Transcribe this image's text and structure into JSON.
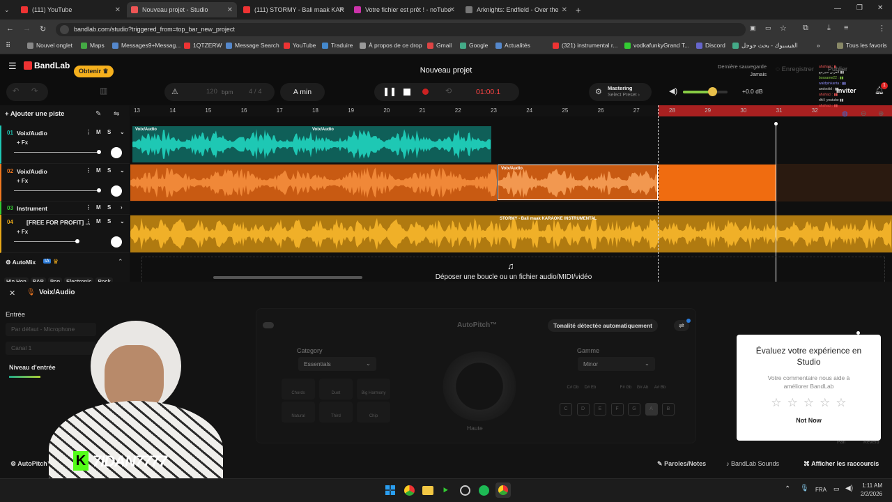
{
  "tabs": [
    {
      "title": "(111) YouTube",
      "color": "#e33"
    },
    {
      "title": "Nouveau projet - Studio",
      "color": "#e55"
    },
    {
      "title": "(111) STORMY - Bali maak KAR",
      "color": "#e33"
    },
    {
      "title": "Votre fichier est prêt ! - noTube",
      "color": "#c3a"
    },
    {
      "title": "Arknights: Endfield - Over the",
      "color": "#777"
    }
  ],
  "url": "bandlab.com/studio?triggered_from=top_bar_new_project",
  "bookmarks": [
    "Nouvel onglet",
    "Maps",
    "Messages9+Messag...",
    "1QTZERW",
    "Message Search",
    "YouTube",
    "Traduire",
    "À propos de ce drop",
    "Gmail",
    "Google",
    "Actualités",
    "(321) instrumental r...",
    "vodkafunkyGrand T...",
    "Discord",
    "الفيسبوك - بحث جوجل",
    "Tous les favoris"
  ],
  "app": {
    "brand": "BandLab",
    "obtenir": "Obtenir",
    "project_title": "Nouveau projet",
    "save_label": "Dernière sauvegarde",
    "save_value": "Jamais",
    "save_button": "Enregistrer",
    "publish_button": "Publier",
    "invite_button": "Inviter"
  },
  "toolbar": {
    "bpm_value": "120",
    "bpm_unit": "bpm",
    "signature": "4 / 4",
    "key": "A min",
    "time": "01:00.1",
    "mastering_title": "Mastering",
    "mastering_sub": "Select Preset",
    "volume_db": "+0.0 dB",
    "volume_level": 0.65
  },
  "ruler": [
    "13",
    "14",
    "15",
    "16",
    "17",
    "18",
    "19",
    "20",
    "21",
    "22",
    "23",
    "24",
    "25",
    "26",
    "27",
    "28",
    "29",
    "30",
    "31",
    "32"
  ],
  "tracks": [
    {
      "num": "01",
      "name": "Voix/Audio",
      "fx": "+ Fx",
      "color": "#1ec8b4",
      "m": "M",
      "s": "S"
    },
    {
      "num": "02",
      "name": "Voix/Audio",
      "fx": "+ Fx",
      "color": "#f07820",
      "m": "M",
      "s": "S"
    },
    {
      "num": "03",
      "name": "Instrument",
      "fx": "",
      "color": "#3c3",
      "m": "M",
      "s": "S"
    },
    {
      "num": "04",
      "name": "[FREE FOR PROFIT] ...",
      "fx": "+ Fx",
      "color": "#e8a818",
      "m": "M",
      "s": "S"
    }
  ],
  "clips": {
    "c1a": "Voix/Audio",
    "c1b": "Voix/Audio",
    "c2": "Voix/Audio",
    "c4": "STORMY - Bali maak KARAOKE INSTRUMENTAL"
  },
  "add_track": "Ajouter une piste",
  "automix": {
    "label": "AutoMix",
    "badge": "IA",
    "genres": [
      "Hip Hop",
      "R&B",
      "Pop",
      "Electronic",
      "Rock"
    ]
  },
  "drop_text": "Déposer une boucle ou un fichier audio/MIDI/vidéo",
  "panel": {
    "track_name": "Voix/Audio",
    "entree": "Entrée",
    "input_device": "Par défaut - Microphone",
    "channel": "Canal 1",
    "level": "Niveau d'entrée",
    "plugin": "AutoPitch™",
    "auto_key": "Tonalité détectée automatiquement",
    "category_label": "Category",
    "category_value": "Essentials",
    "gamme_label": "Gamme",
    "gamme_value": "Minor",
    "knob_label": "Haute",
    "modes": [
      "Chords",
      "Duet",
      "Big Harmony",
      "Natural",
      "Third",
      "Chip"
    ],
    "keys_top": [
      "C#\nDb",
      "D#\nEb",
      "F#\nGb",
      "G#\nAb",
      "A#\nBb"
    ],
    "keys_bottom": [
      "C",
      "D",
      "E",
      "F",
      "G",
      "A",
      "B"
    ],
    "pan": "Pan",
    "reverb": "Reverb",
    "bottom_left": "AutoPitch™",
    "lyrics": "Paroles/Notes",
    "sounds": "BandLab Sounds",
    "shortcuts": "Afficher les raccourcis"
  },
  "rating": {
    "title": "Évaluez votre expérience en Studio",
    "body": "Votre commentaire nous aide à améliorer BandLab",
    "not_now": "Not Now"
  },
  "streamer": "7IDAN7777",
  "taskbar": {
    "lang": "FRA",
    "time": "1:11 AM",
    "date": "2/2/2026"
  }
}
